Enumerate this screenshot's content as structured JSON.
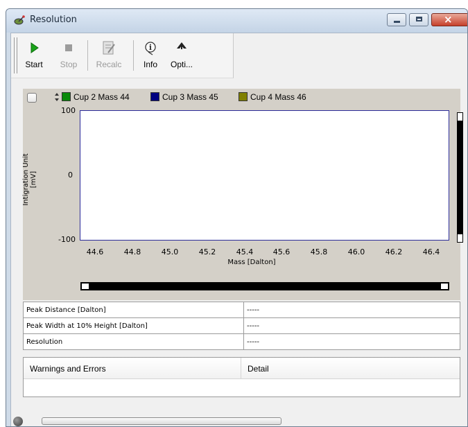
{
  "window": {
    "title": "Resolution",
    "icon": "satellite-dish-icon",
    "controls": {
      "minimize": "minimize-icon",
      "maximize": "maximize-icon",
      "close": "×"
    }
  },
  "toolbar": {
    "buttons": [
      {
        "label": "Start",
        "icon": "play-icon",
        "enabled": true
      },
      {
        "label": "Stop",
        "icon": "stop-icon",
        "enabled": false
      },
      {
        "label": "Recalc",
        "icon": "recalc-icon",
        "enabled": false
      },
      {
        "label": "Info",
        "icon": "info-icon",
        "enabled": true
      },
      {
        "label": "Opti...",
        "icon": "hammer-icon",
        "enabled": true
      }
    ]
  },
  "chart_data": {
    "type": "line",
    "title": "",
    "xlabel": "Mass [Dalton]",
    "ylabel": "Intigration Unit [mV]",
    "xlim": [
      44.5,
      46.5
    ],
    "ylim": [
      -100,
      100
    ],
    "x_ticks": [
      "44.6",
      "44.8",
      "45.0",
      "45.2",
      "45.4",
      "45.6",
      "45.8",
      "46.0",
      "46.2",
      "46.4"
    ],
    "y_ticks": [
      "100",
      "0",
      "-100"
    ],
    "series": [
      {
        "name": "Cup 2 Mass 44",
        "color": "#0a8a0a",
        "values": []
      },
      {
        "name": "Cup 3 Mass 45",
        "color": "#000080",
        "values": []
      },
      {
        "name": "Cup 4 Mass 46",
        "color": "#808000",
        "values": []
      }
    ],
    "legend": "top-left",
    "grid": false
  },
  "results": {
    "rows": [
      {
        "label": "Peak Distance [Dalton]",
        "value": "-----"
      },
      {
        "label": "Peak Width at 10% Height [Dalton]",
        "value": "-----"
      },
      {
        "label": "Resolution",
        "value": "-----"
      }
    ]
  },
  "warnings": {
    "col1": "Warnings and Errors",
    "col2": "Detail"
  },
  "status": {
    "led": "status-led-icon",
    "progress": 0
  }
}
